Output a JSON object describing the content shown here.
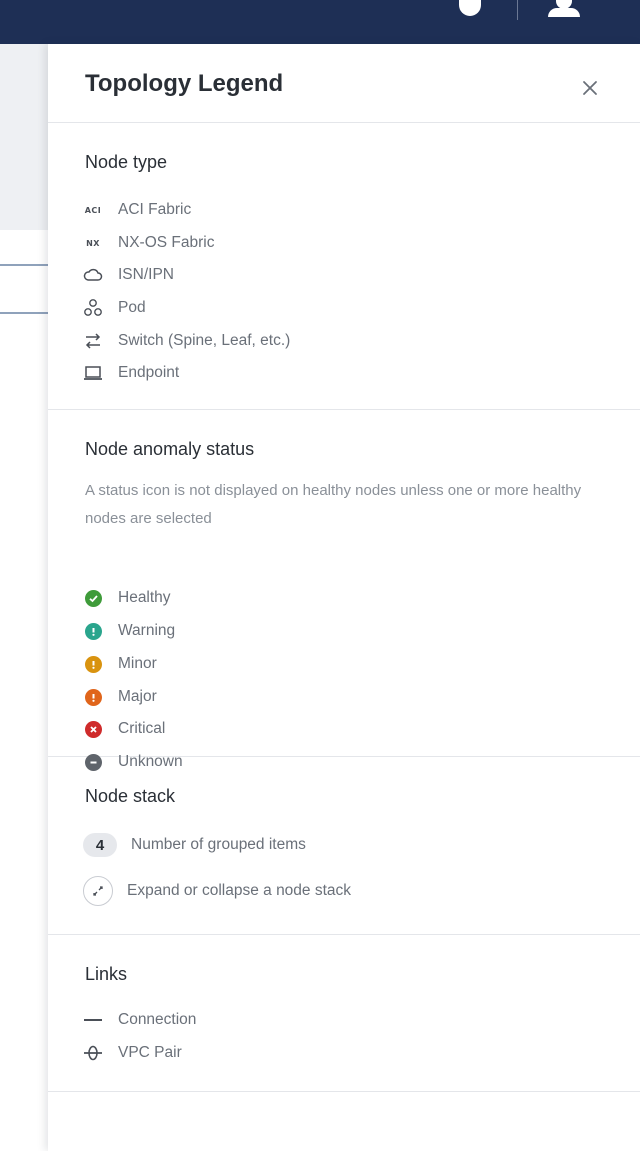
{
  "panel": {
    "title": "Topology Legend",
    "close_label": "×"
  },
  "node_type": {
    "title": "Node type",
    "items": [
      {
        "icon": "ACI",
        "icon_name": "aci-text-icon",
        "label": "ACI Fabric"
      },
      {
        "icon": "NX",
        "icon_name": "nx-text-icon",
        "label": "NX-OS Fabric"
      },
      {
        "icon_name": "cloud-icon",
        "label": "ISN/IPN"
      },
      {
        "icon_name": "pod-icon",
        "label": "Pod"
      },
      {
        "icon_name": "switch-arrows-icon",
        "label": "Switch (Spine, Leaf, etc.)"
      },
      {
        "icon_name": "laptop-icon",
        "label": "Endpoint"
      }
    ]
  },
  "anomaly": {
    "title": "Node anomaly status",
    "description": "A status icon is not displayed on healthy nodes unless one or more healthy nodes are selected",
    "items": [
      {
        "icon_name": "healthy-check-icon",
        "color": "#3f9b3a",
        "label": "Healthy"
      },
      {
        "icon_name": "warning-icon",
        "color": "#2aa58d",
        "label": "Warning"
      },
      {
        "icon_name": "minor-icon",
        "color": "#d9930f",
        "label": "Minor"
      },
      {
        "icon_name": "major-icon",
        "color": "#e0651b",
        "label": "Major"
      },
      {
        "icon_name": "critical-x-icon",
        "color": "#cf2b2b",
        "label": "Critical"
      },
      {
        "icon_name": "unknown-minus-icon",
        "color": "#5f646b",
        "label": "Unknown"
      }
    ]
  },
  "node_stack": {
    "title": "Node stack",
    "count_badge": "4",
    "count_label": "Number of grouped items",
    "expand_label": "Expand or collapse a node stack"
  },
  "links": {
    "title": "Links",
    "items": [
      {
        "icon_name": "connection-line-icon",
        "label": "Connection"
      },
      {
        "icon_name": "vpc-pair-icon",
        "label": "VPC Pair"
      }
    ]
  }
}
